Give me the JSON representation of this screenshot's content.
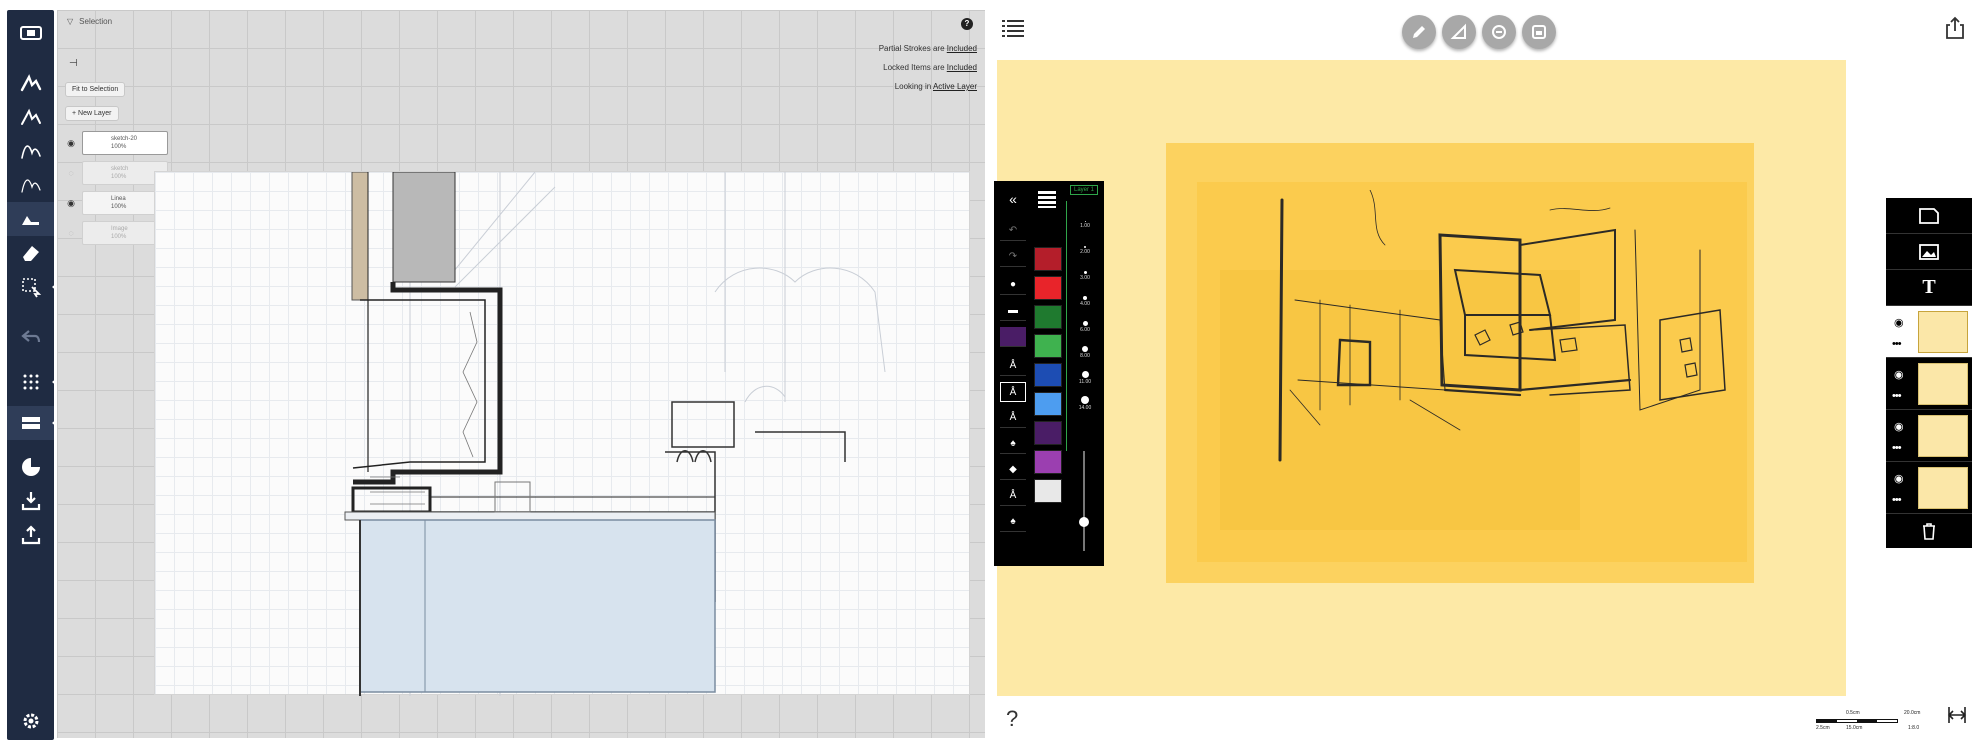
{
  "left_app": {
    "toolbar": {
      "tools": [
        {
          "name": "film-icon"
        },
        {
          "name": "pen-1-icon"
        },
        {
          "name": "pen-2-icon"
        },
        {
          "name": "pen-3-icon"
        },
        {
          "name": "pen-4-icon"
        },
        {
          "name": "pen-5-icon",
          "active": true
        },
        {
          "name": "eraser-icon"
        },
        {
          "name": "selection-tool-icon"
        },
        {
          "name": "undo-icon"
        },
        {
          "name": "grid-icon"
        },
        {
          "name": "layers-icon"
        },
        {
          "name": "color-palette-icon"
        },
        {
          "name": "import-icon"
        },
        {
          "name": "export-icon"
        },
        {
          "name": "settings-icon"
        }
      ]
    },
    "selection_label": "Selection",
    "notices": [
      {
        "prefix": "Partial Strokes are ",
        "link": "Included"
      },
      {
        "prefix": "Locked Items are ",
        "link": "Included"
      },
      {
        "prefix": "Looking in ",
        "link": "Active Layer"
      }
    ],
    "buttons": {
      "fit_to_selection": "Fit to Selection",
      "new_layer": "New Layer"
    },
    "layers": [
      {
        "name": "sketch-20",
        "opacity": "100%",
        "active": true
      },
      {
        "name": "sketch",
        "opacity": "100%",
        "active": false
      },
      {
        "name": "Linea",
        "opacity": "100%",
        "active": false
      },
      {
        "name": "Image",
        "opacity": "100%",
        "active": false
      }
    ]
  },
  "right_app": {
    "top_tools": [
      "pencil-icon",
      "ruler-icon",
      "stamp-icon",
      "layer-image-icon"
    ],
    "pen_panel": {
      "layer_tab": "Layer 1",
      "swatches": [
        "#b41e2a",
        "#e8242a",
        "#1f7a2f",
        "#3fb24f",
        "#1d4db3",
        "#4d9df0",
        "#4a1d66",
        "#9b3fb0",
        "#e8e8e8"
      ],
      "sizes": [
        "1.00",
        "2.00",
        "3.00",
        "4.00",
        "6.00",
        "8.00",
        "11.00",
        "14.00"
      ]
    },
    "layers_panel": {
      "buttons": [
        "new-page-icon",
        "insert-image-icon",
        "text-icon"
      ],
      "layer_count": 4,
      "selected_index": 0
    },
    "help_label": "?",
    "scale_bar": {
      "top_left": "0.5cm",
      "top_right": "20.0cm",
      "bottom": [
        "2.5cm",
        "15.0cm",
        "1:8.0"
      ]
    },
    "colors": {
      "sheet": "#fde9a6",
      "trace": "#fccf58",
      "toolbar": "#1f2b42"
    }
  }
}
